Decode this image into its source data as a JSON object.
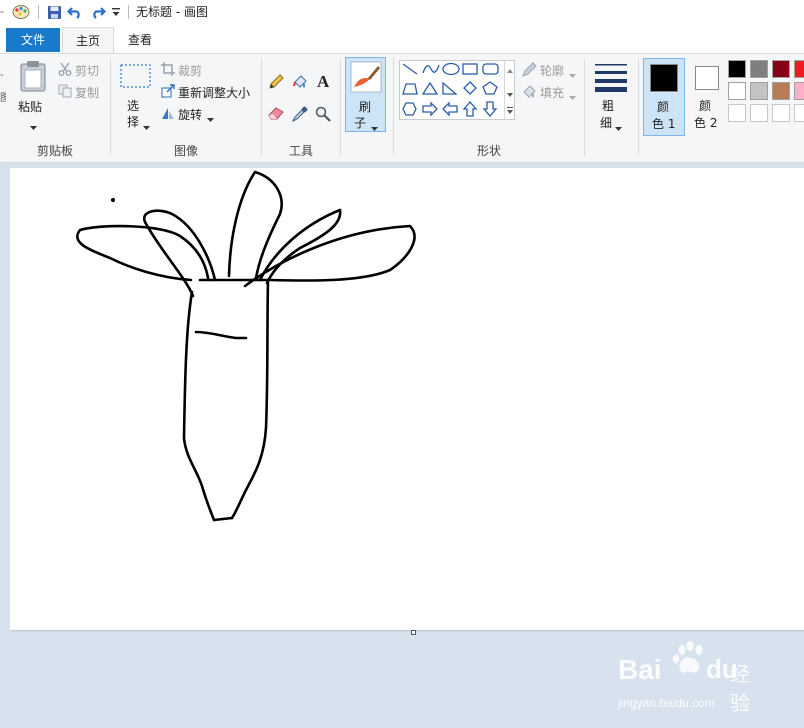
{
  "window": {
    "title": "无标题 - 画图"
  },
  "tabs": [
    {
      "label": "文件"
    },
    {
      "label": "主页"
    },
    {
      "label": "查看"
    }
  ],
  "clipboard": {
    "paste": "粘贴",
    "cut": "剪切",
    "copy": "复制",
    "group": "剪贴板"
  },
  "image": {
    "select_1": "选",
    "select_2": "择",
    "crop": "裁剪",
    "resize": "重新调整大小",
    "rotate": "旋转",
    "group": "图像"
  },
  "tools": {
    "group": "工具"
  },
  "brushes": {
    "label_1": "刷",
    "label_2": "子"
  },
  "shapes": {
    "outline": "轮廓",
    "fill": "填充",
    "group": "形状"
  },
  "size": {
    "label_1": "粗",
    "label_2": "细"
  },
  "colors": {
    "color1_1": "颜",
    "color1_2": "色 1",
    "color2_1": "颜",
    "color2_2": "色 2",
    "color1_value": "#000000",
    "color2_value": "#ffffff",
    "palette_row1": [
      "#000000",
      "#7f7f7f",
      "#880015",
      "#ed1c24"
    ],
    "palette_row2": [
      "#ffffff",
      "#c3c3c3",
      "#b97a57",
      "#ffaec9"
    ],
    "palette_row3": [
      "#ffffff",
      "#ffffff",
      "#ffffff",
      "#ffffff"
    ]
  },
  "watermark": {
    "brand": "Bai",
    "brand2": "du",
    "suffix": "经验",
    "url": "jingyan.baidu.com"
  }
}
